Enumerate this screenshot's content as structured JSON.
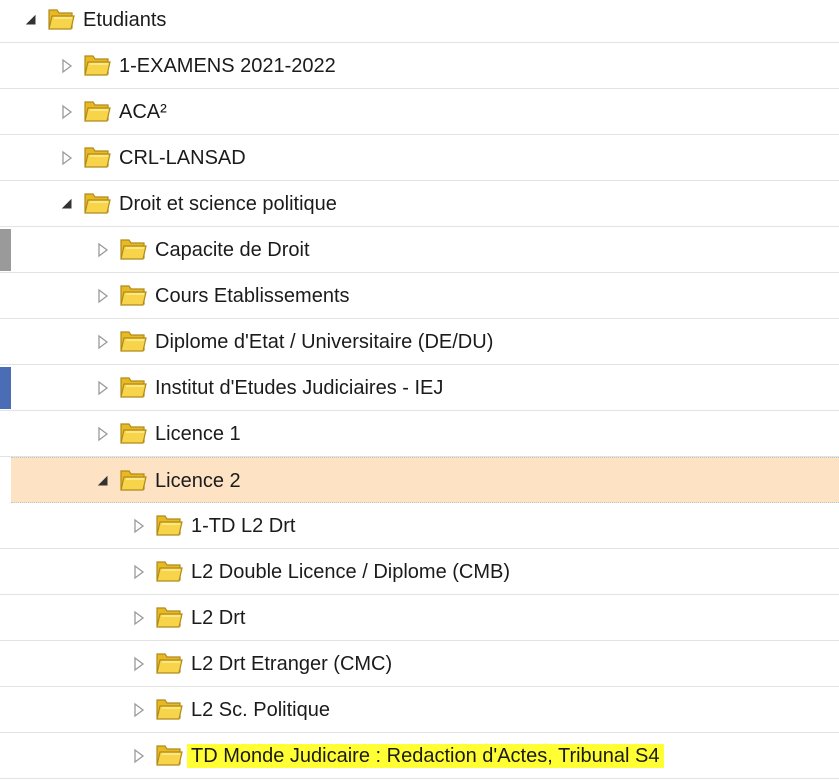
{
  "tree": {
    "items": [
      {
        "label": "Etudiants",
        "depth": 0,
        "expanded": true,
        "highlight": false,
        "selected": false
      },
      {
        "label": "1-EXAMENS 2021-2022",
        "depth": 1,
        "expanded": false,
        "highlight": false,
        "selected": false
      },
      {
        "label": "ACA²",
        "depth": 1,
        "expanded": false,
        "highlight": false,
        "selected": false
      },
      {
        "label": "CRL-LANSAD",
        "depth": 1,
        "expanded": false,
        "highlight": false,
        "selected": false
      },
      {
        "label": "Droit et science politique",
        "depth": 1,
        "expanded": true,
        "highlight": false,
        "selected": false
      },
      {
        "label": "Capacite de Droit",
        "depth": 2,
        "expanded": false,
        "highlight": false,
        "selected": false,
        "marker": "#9a9a9a"
      },
      {
        "label": "Cours Etablissements",
        "depth": 2,
        "expanded": false,
        "highlight": false,
        "selected": false
      },
      {
        "label": "Diplome d'Etat / Universitaire (DE/DU)",
        "depth": 2,
        "expanded": false,
        "highlight": false,
        "selected": false
      },
      {
        "label": "Institut d'Etudes Judiciaires - IEJ",
        "depth": 2,
        "expanded": false,
        "highlight": false,
        "selected": false,
        "marker": "#4a6db5"
      },
      {
        "label": "Licence 1",
        "depth": 2,
        "expanded": false,
        "highlight": false,
        "selected": false
      },
      {
        "label": "Licence 2",
        "depth": 2,
        "expanded": true,
        "highlight": false,
        "selected": true
      },
      {
        "label": "1-TD L2 Drt",
        "depth": 3,
        "expanded": false,
        "highlight": false,
        "selected": false
      },
      {
        "label": "L2 Double Licence / Diplome (CMB)",
        "depth": 3,
        "expanded": false,
        "highlight": false,
        "selected": false
      },
      {
        "label": "L2 Drt",
        "depth": 3,
        "expanded": false,
        "highlight": false,
        "selected": false
      },
      {
        "label": "L2 Drt Etranger (CMC)",
        "depth": 3,
        "expanded": false,
        "highlight": false,
        "selected": false
      },
      {
        "label": "L2 Sc. Politique",
        "depth": 3,
        "expanded": false,
        "highlight": false,
        "selected": false
      },
      {
        "label": "TD Monde Judicaire : Redaction d'Actes, Tribunal S4",
        "depth": 3,
        "expanded": false,
        "highlight": true,
        "selected": false
      }
    ]
  },
  "icons": {
    "folder": "folder-icon",
    "expanded": "triangle-expanded-icon",
    "collapsed": "triangle-collapsed-icon"
  },
  "colors": {
    "selected_row": "#fde3c4",
    "highlight": "#ffff33",
    "folder_fill": "#f7d44a",
    "folder_stroke": "#b08a1a"
  }
}
